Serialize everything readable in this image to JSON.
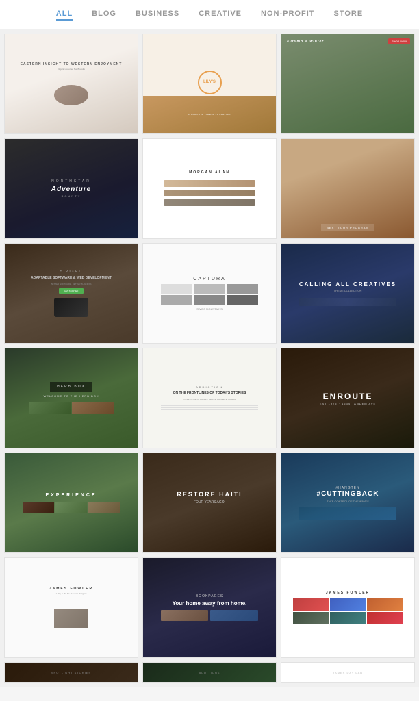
{
  "nav": {
    "items": [
      {
        "id": "all",
        "label": "ALL",
        "active": true
      },
      {
        "id": "blog",
        "label": "BLOG",
        "active": false
      },
      {
        "id": "business",
        "label": "BUSINESS",
        "active": false
      },
      {
        "id": "creative",
        "label": "CREATIVE",
        "active": false
      },
      {
        "id": "nonprofit",
        "label": "NON-PROFIT",
        "active": false
      },
      {
        "id": "store",
        "label": "STORE",
        "active": false
      }
    ]
  },
  "cards": {
    "row1": [
      {
        "id": "tea",
        "title": "EASTERN INSIGHT TO WESTERN ENJOYMENT",
        "sub": "Organic Assorted Tea Biscuits"
      },
      {
        "id": "lily",
        "title": "LILY'S"
      },
      {
        "id": "girl",
        "title": ""
      }
    ],
    "row2": [
      {
        "id": "adventure",
        "title": "Adventure",
        "brand": "NORTHSTAR",
        "sub": "BOUNTY"
      },
      {
        "id": "glasses",
        "title": "MORGAN ALAN"
      },
      {
        "id": "park",
        "title": "BEST TOUR PROGRAM"
      }
    ],
    "row3": [
      {
        "id": "pixel",
        "title": "ADAPTABLE SOFTWARE & WEB DEVELOPMENT",
        "sub": "BETTER SOFTWARE, BETTER BUSINESS"
      },
      {
        "id": "captura",
        "title": "CAPTURA"
      },
      {
        "id": "creatives",
        "title": "CALLING ALL CREATIVES"
      }
    ],
    "row4": [
      {
        "id": "herb",
        "title": "HERB BOX",
        "sub": "WELCOME TO THE HERB BOX"
      },
      {
        "id": "addiction",
        "title": "ON THE FRONTLINES OF TODAY'S STORIES",
        "label": "ADDICTION",
        "date": "CAFFEINE HIGH: COFFEE PRICES CONTINUE TO RISE"
      },
      {
        "id": "enroute",
        "title": "ENROUTE",
        "sub": "EST 1975 · 1634 TANDEM AVE"
      }
    ],
    "row5": [
      {
        "id": "experience",
        "title": "EXPERIENCE"
      },
      {
        "id": "restore",
        "title": "RESTORE HAITI",
        "sub": "FOUR YEARS AGO,"
      },
      {
        "id": "cuttingback",
        "title": "#CUTTINGBACK",
        "label": "#HANGTEN",
        "sub": "TAKE CONTROL OF THE WAVES"
      }
    ],
    "row6": [
      {
        "id": "blog2",
        "title": "JAMES FOWLER"
      },
      {
        "id": "bookpages",
        "title": "Your home away from home.",
        "label": "BOOKPAGES"
      },
      {
        "id": "portfolio",
        "title": "JAMES FOWLER"
      }
    ],
    "row7": [
      {
        "id": "spotlight",
        "label": "SPOTLIGHT STORIES"
      },
      {
        "id": "additions",
        "label": "ADDITIONS"
      },
      {
        "id": "blank",
        "label": "JAMES DAY LAB"
      }
    ]
  }
}
